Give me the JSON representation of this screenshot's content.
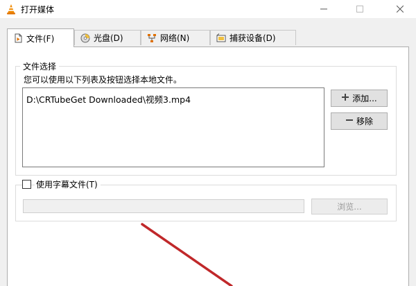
{
  "window": {
    "title": "打开媒体",
    "icon": "vlc-cone-icon"
  },
  "tabs": [
    {
      "label": "文件(F)",
      "icon": "file-icon",
      "active": true
    },
    {
      "label": "光盘(D)",
      "icon": "disc-icon",
      "active": false
    },
    {
      "label": "网络(N)",
      "icon": "network-icon",
      "active": false
    },
    {
      "label": "捕获设备(D)",
      "icon": "capture-device-icon",
      "active": false
    }
  ],
  "file_selection": {
    "group_label": "文件选择",
    "description": "您可以使用以下列表及按钮选择本地文件。",
    "files": [
      "D:\\CRTubeGet Downloaded\\视频3.mp4"
    ],
    "add_label": "添加...",
    "remove_label": "移除"
  },
  "subtitle": {
    "label": "使用字幕文件(T)",
    "checked": false,
    "path_value": "",
    "browse_label": "浏览..."
  },
  "colors": {
    "accent_arrow": "#c0282a",
    "vlc_orange": "#f08a00"
  }
}
